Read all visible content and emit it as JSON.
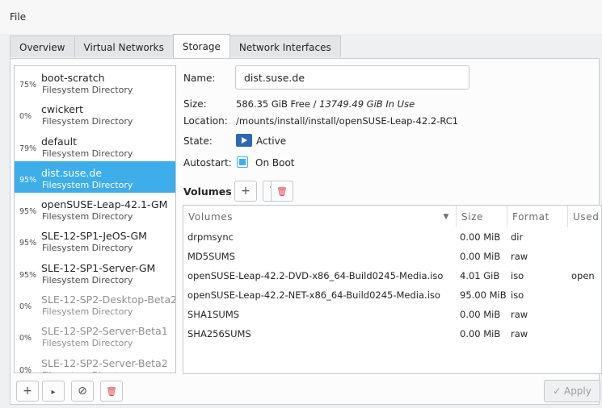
{
  "menubar": {
    "file": "File"
  },
  "tabs": [
    {
      "label": "Overview"
    },
    {
      "label": "Virtual Networks"
    },
    {
      "label": "Storage"
    },
    {
      "label": "Network Interfaces"
    }
  ],
  "pools": [
    {
      "pct": "75%",
      "name": "boot-scratch",
      "type": "Filesystem Directory"
    },
    {
      "pct": "0%",
      "name": "cwickert",
      "type": "Filesystem Directory"
    },
    {
      "pct": "79%",
      "name": "default",
      "type": "Filesystem Directory"
    },
    {
      "pct": "95%",
      "name": "dist.suse.de",
      "type": "Filesystem Directory"
    },
    {
      "pct": "95%",
      "name": "openSUSE-Leap-42.1-GM",
      "type": "Filesystem Directory"
    },
    {
      "pct": "95%",
      "name": "SLE-12-SP1-JeOS-GM",
      "type": "Filesystem Directory"
    },
    {
      "pct": "95%",
      "name": "SLE-12-SP1-Server-GM",
      "type": "Filesystem Directory"
    },
    {
      "pct": "0%",
      "name": "SLE-12-SP2-Desktop-Beta2",
      "type": "Filesystem Directory"
    },
    {
      "pct": "0%",
      "name": "SLE-12-SP2-Server-Beta1",
      "type": "Filesystem Directory"
    },
    {
      "pct": "0%",
      "name": "SLE-12-SP2-Server-Beta2",
      "type": "Filesystem Directory"
    }
  ],
  "details": {
    "name_label": "Name:",
    "name_value": "dist.suse.de",
    "size_label": "Size:",
    "size_free": "586.35 GiB Free / ",
    "size_inuse": "13749.49 GiB In Use",
    "location_label": "Location:",
    "location_value": "/mounts/install/install/openSUSE-Leap-42.2-RC1",
    "state_label": "State:",
    "state_value": "Active",
    "autostart_label": "Autostart:",
    "autostart_value": "On Boot",
    "volumes_label": "Volumes"
  },
  "toolbar": {
    "add": "+",
    "refresh": "↻",
    "delete": "🗑"
  },
  "volumes": {
    "headers": {
      "name": "Volumes",
      "size": "Size",
      "format": "Format",
      "used": "Used"
    },
    "rows": [
      {
        "name": "drpmsync",
        "size": "0.00 MiB",
        "format": "dir",
        "used": ""
      },
      {
        "name": "MD5SUMS",
        "size": "0.00 MiB",
        "format": "raw",
        "used": ""
      },
      {
        "name": "openSUSE-Leap-42.2-DVD-x86_64-Build0245-Media.iso",
        "size": "4.01 GiB",
        "format": "iso",
        "used": "open"
      },
      {
        "name": "openSUSE-Leap-42.2-NET-x86_64-Build0245-Media.iso",
        "size": "95.00 MiB",
        "format": "iso",
        "used": ""
      },
      {
        "name": "SHA1SUMS",
        "size": "0.00 MiB",
        "format": "raw",
        "used": ""
      },
      {
        "name": "SHA256SUMS",
        "size": "0.00 MiB",
        "format": "raw",
        "used": ""
      }
    ]
  },
  "bottom": {
    "add": "+",
    "start": "▸",
    "stop": "⊘",
    "delete": "🗑",
    "apply": "Apply"
  },
  "colors": {
    "selection": "#3daee9",
    "delete": "#da4453"
  }
}
